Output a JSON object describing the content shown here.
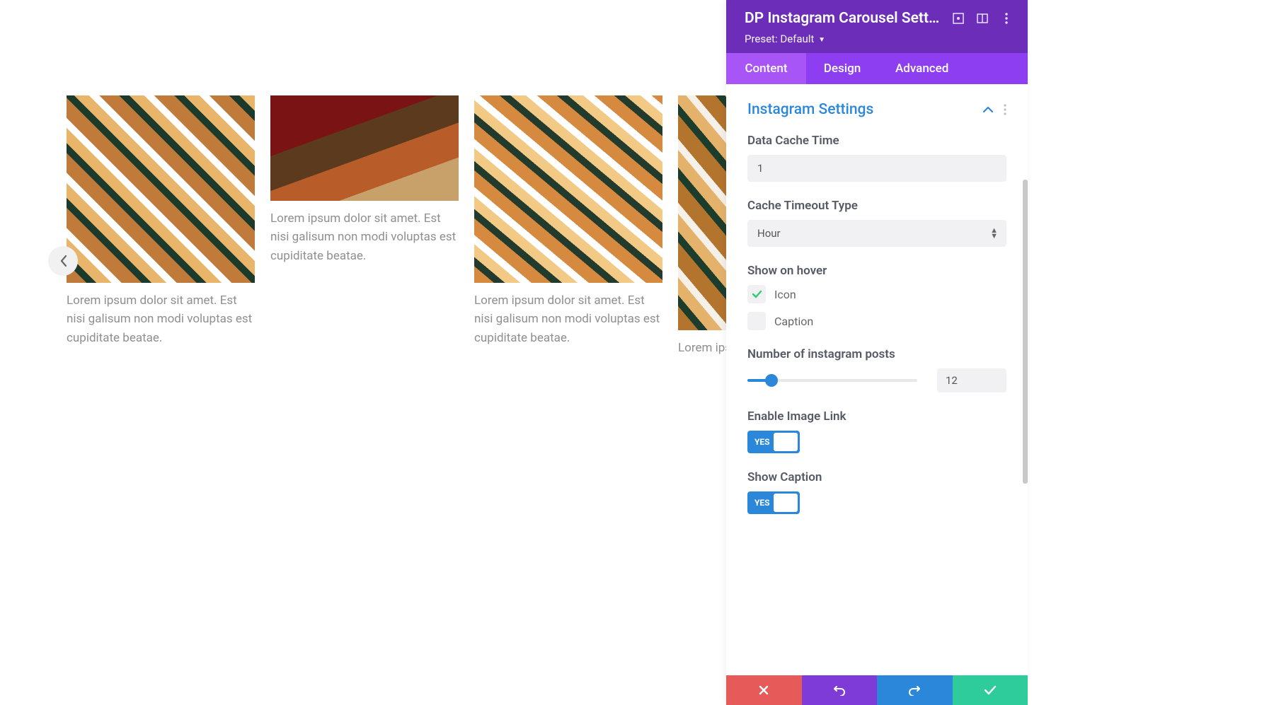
{
  "carousel": {
    "items": [
      {
        "caption": "Lorem ipsum dolor sit amet. Est nisi galisum non modi voluptas est cupiditate beatae."
      },
      {
        "caption": "Lorem ipsum dolor sit amet. Est nisi galisum non modi voluptas est cupiditate beatae."
      },
      {
        "caption": "Lorem ipsum dolor sit amet. Est nisi galisum non modi voluptas est cupiditate beatae."
      },
      {
        "caption": "Lorem ipsum dolor sit amet. Est nisi galisum non modi voluptas est cupiditate beatae."
      }
    ]
  },
  "panel": {
    "title": "DP Instagram Carousel Sett…",
    "preset": {
      "label": "Preset:",
      "value": "Default"
    },
    "tabs": {
      "content": "Content",
      "design": "Design",
      "advanced": "Advanced",
      "active": "content"
    },
    "section": {
      "title": "Instagram Settings"
    },
    "fields": {
      "data_cache_time": {
        "label": "Data Cache Time",
        "value": "1"
      },
      "cache_timeout_type": {
        "label": "Cache Timeout Type",
        "value": "Hour"
      },
      "show_on_hover": {
        "label": "Show on hover",
        "icon": {
          "label": "Icon",
          "checked": true
        },
        "caption": {
          "label": "Caption",
          "checked": false
        }
      },
      "num_posts": {
        "label": "Number of instagram posts",
        "value": "12"
      },
      "enable_image_link": {
        "label": "Enable Image Link",
        "value": "YES"
      },
      "show_caption": {
        "label": "Show Caption",
        "value": "YES"
      }
    },
    "colors": {
      "header": "#6c2eb9",
      "tabs_bg": "#8d3ef0",
      "tab_active": "#a855f7",
      "accent": "#2b87da",
      "success": "#2ecc71",
      "danger": "#e65a5a",
      "save": "#2ecc9a"
    }
  }
}
